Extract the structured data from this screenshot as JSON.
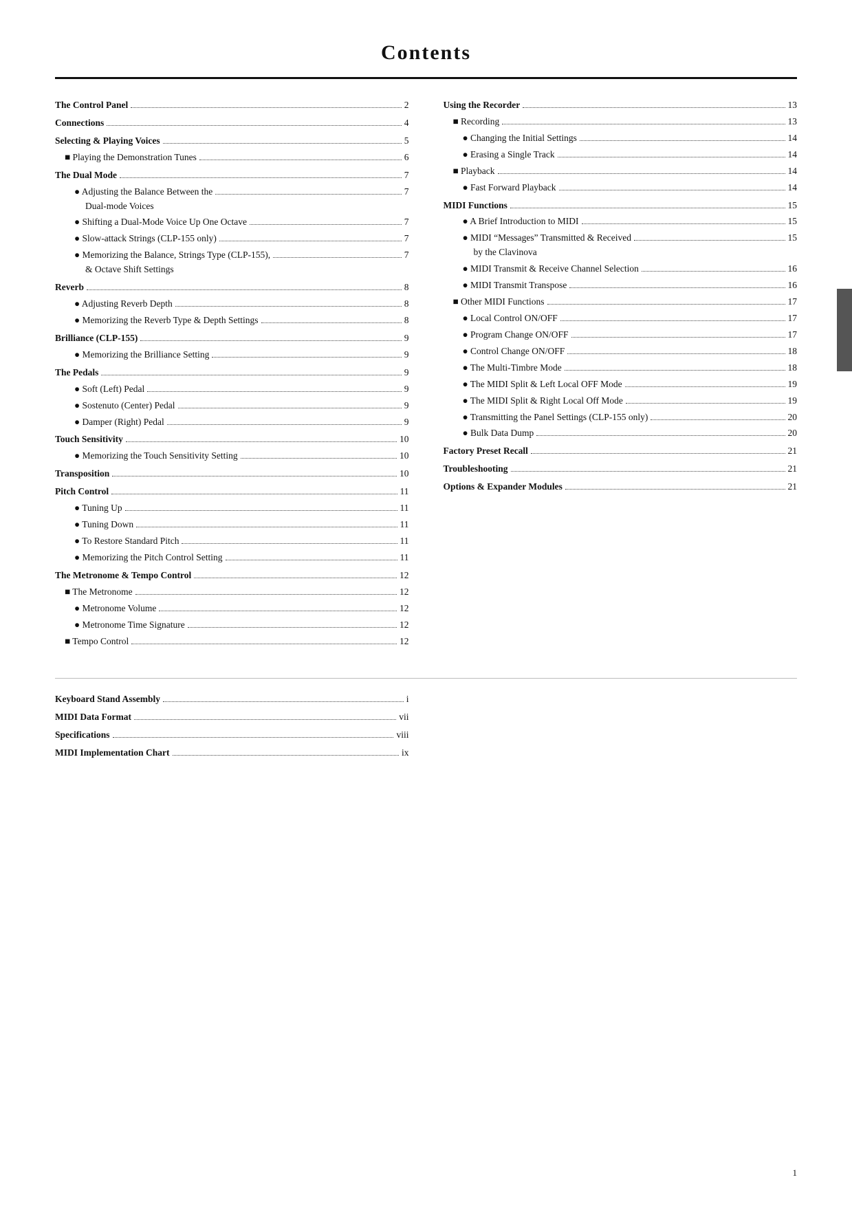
{
  "title": "Contents",
  "left_col": [
    {
      "type": "bold-entry",
      "label": "The Control Panel",
      "page": "2"
    },
    {
      "type": "bold-entry",
      "label": "Connections",
      "page": "4"
    },
    {
      "type": "bold-entry",
      "label": "Selecting & Playing Voices",
      "page": "5"
    },
    {
      "type": "sq-entry",
      "label": "Playing the Demonstration Tunes",
      "page": "6"
    },
    {
      "type": "bold-entry",
      "label": "The Dual Mode",
      "page": "7"
    },
    {
      "type": "circ-entry",
      "label": "Adjusting the Balance Between the Dual-mode Voices",
      "page": "7",
      "wrap": true
    },
    {
      "type": "circ-entry",
      "label": "Shifting a Dual-Mode Voice Up One Octave",
      "page": "7"
    },
    {
      "type": "circ-entry",
      "label": "Slow-attack Strings (CLP-155 only)",
      "page": "7"
    },
    {
      "type": "circ-entry",
      "label": "Memorizing the Balance, Strings Type (CLP-155), & Octave Shift Settings",
      "page": "7",
      "wrap": true
    },
    {
      "type": "bold-entry",
      "label": "Reverb",
      "page": "8"
    },
    {
      "type": "circ-entry",
      "label": "Adjusting Reverb Depth",
      "page": "8"
    },
    {
      "type": "circ-entry",
      "label": "Memorizing the Reverb Type & Depth Settings",
      "page": "8"
    },
    {
      "type": "bold-entry",
      "label": "Brilliance (CLP-155)",
      "page": "9"
    },
    {
      "type": "circ-entry",
      "label": "Memorizing the Brilliance Setting",
      "page": "9"
    },
    {
      "type": "bold-entry",
      "label": "The Pedals",
      "page": "9"
    },
    {
      "type": "circ-entry",
      "label": "Soft (Left) Pedal",
      "page": "9"
    },
    {
      "type": "circ-entry",
      "label": "Sostenuto (Center) Pedal",
      "page": "9"
    },
    {
      "type": "circ-entry",
      "label": "Damper (Right) Pedal",
      "page": "9"
    },
    {
      "type": "bold-entry",
      "label": "Touch Sensitivity",
      "page": "10"
    },
    {
      "type": "circ-entry",
      "label": "Memorizing the Touch Sensitivity Setting",
      "page": "10"
    },
    {
      "type": "bold-entry",
      "label": "Transposition",
      "page": "10"
    },
    {
      "type": "bold-entry",
      "label": "Pitch Control",
      "page": "11"
    },
    {
      "type": "circ-entry",
      "label": "Tuning Up",
      "page": "11"
    },
    {
      "type": "circ-entry",
      "label": "Tuning Down",
      "page": "11"
    },
    {
      "type": "circ-entry",
      "label": "To Restore Standard Pitch",
      "page": "11"
    },
    {
      "type": "circ-entry",
      "label": "Memorizing the Pitch Control Setting",
      "page": "11"
    },
    {
      "type": "bold-entry",
      "label": "The Metronome & Tempo Control",
      "page": "12"
    },
    {
      "type": "sq-entry",
      "label": "The Metronome",
      "page": "12"
    },
    {
      "type": "circ-entry",
      "label": "Metronome Volume",
      "page": "12"
    },
    {
      "type": "circ-entry",
      "label": "Metronome Time Signature",
      "page": "12"
    },
    {
      "type": "sq-entry",
      "label": "Tempo Control",
      "page": "12"
    }
  ],
  "right_col": [
    {
      "type": "bold-entry",
      "label": "Using the Recorder",
      "page": "13"
    },
    {
      "type": "sq-entry",
      "label": "Recording",
      "page": "13"
    },
    {
      "type": "circ-entry",
      "label": "Changing the Initial Settings",
      "page": "14"
    },
    {
      "type": "circ-entry",
      "label": "Erasing a Single Track",
      "page": "14"
    },
    {
      "type": "sq-entry",
      "label": "Playback",
      "page": "14"
    },
    {
      "type": "circ-entry",
      "label": "Fast Forward Playback",
      "page": "14"
    },
    {
      "type": "bold-entry",
      "label": "MIDI Functions",
      "page": "15"
    },
    {
      "type": "circ-entry",
      "label": "A Brief Introduction to MIDI",
      "page": "15"
    },
    {
      "type": "circ-entry",
      "label": "MIDI “Messages” Transmitted & Received by the Clavinova",
      "page": "15",
      "wrap": true
    },
    {
      "type": "circ-entry",
      "label": "MIDI Transmit & Receive Channel Selection",
      "page": "16"
    },
    {
      "type": "circ-entry",
      "label": "MIDI Transmit Transpose",
      "page": "16"
    },
    {
      "type": "sq-entry",
      "label": "Other MIDI Functions",
      "page": "17"
    },
    {
      "type": "circ-entry",
      "label": "Local Control ON/OFF",
      "page": "17"
    },
    {
      "type": "circ-entry",
      "label": "Program Change ON/OFF",
      "page": "17"
    },
    {
      "type": "circ-entry",
      "label": "Control Change ON/OFF",
      "page": "18"
    },
    {
      "type": "circ-entry",
      "label": "The Multi-Timbre Mode",
      "page": "18"
    },
    {
      "type": "circ-entry",
      "label": "The MIDI Split & Left Local OFF Mode",
      "page": "19"
    },
    {
      "type": "circ-entry",
      "label": "The MIDI Split & Right Local Off Mode",
      "page": "19"
    },
    {
      "type": "circ-entry",
      "label": "Transmitting the Panel Settings (CLP-155 only)",
      "page": "20"
    },
    {
      "type": "circ-entry",
      "label": "Bulk Data Dump",
      "page": "20"
    },
    {
      "type": "bold-entry",
      "label": "Factory Preset Recall",
      "page": "21"
    },
    {
      "type": "bold-entry",
      "label": "Troubleshooting",
      "page": "21"
    },
    {
      "type": "bold-entry",
      "label": "Options & Expander Modules",
      "page": "21"
    }
  ],
  "bottom_left": [
    {
      "type": "bold-entry",
      "label": "Keyboard Stand Assembly",
      "page": "i"
    },
    {
      "type": "bold-entry",
      "label": "MIDI Data Format",
      "page": "vii"
    },
    {
      "type": "bold-entry",
      "label": "Specifications",
      "page": "viii"
    },
    {
      "type": "bold-entry",
      "label": "MIDI Implementation Chart",
      "page": "ix"
    }
  ],
  "page_number": "1"
}
